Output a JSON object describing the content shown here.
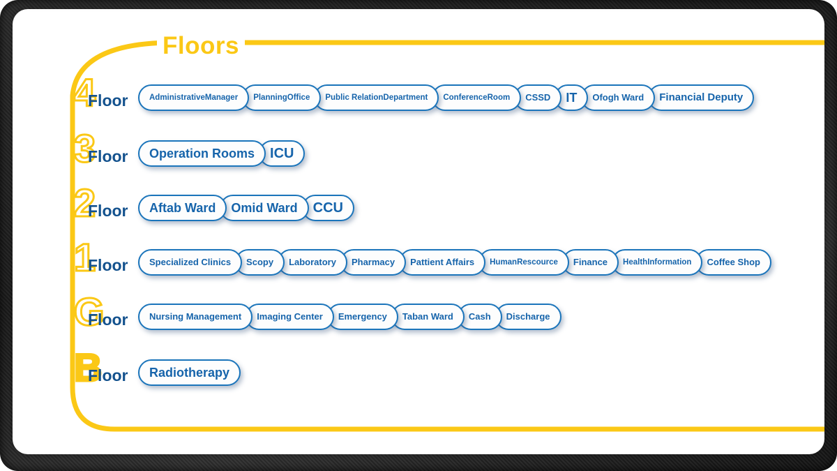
{
  "title": "Floors",
  "colors": {
    "accent_yellow": "#fbc816",
    "pill_border_blue": "#1b75bb",
    "pill_text_blue": "#1664ab",
    "floor_word_blue": "#14528e",
    "card_background": "#ffffff",
    "frame_dark": "#1d1d1d"
  },
  "floor_word": "Floor",
  "floors": [
    {
      "number": "4",
      "label": "Floor",
      "rooms": [
        {
          "lines": [
            "Administrative",
            "Manager"
          ],
          "size": "size-sm"
        },
        {
          "lines": [
            "Planning",
            "Office"
          ],
          "size": "size-sm"
        },
        {
          "lines": [
            "Public Relation",
            "Department"
          ],
          "size": "size-sm"
        },
        {
          "lines": [
            "Conference",
            "Room"
          ],
          "size": "size-sm"
        },
        {
          "lines": [
            "CSSD"
          ],
          "size": "size-md"
        },
        {
          "lines": [
            "IT"
          ],
          "size": "size-xl"
        },
        {
          "lines": [
            "Ofogh Ward"
          ],
          "size": "size-md"
        },
        {
          "lines": [
            "Financial Deputy"
          ],
          "size": "size-lg"
        }
      ]
    },
    {
      "number": "3",
      "label": "Floor",
      "rooms": [
        {
          "lines": [
            "Operation Rooms"
          ],
          "size": "size-xl"
        },
        {
          "lines": [
            "ICU"
          ],
          "size": "size-xxl"
        }
      ]
    },
    {
      "number": "2",
      "label": "Floor",
      "rooms": [
        {
          "lines": [
            "Aftab Ward"
          ],
          "size": "size-xl"
        },
        {
          "lines": [
            "Omid Ward"
          ],
          "size": "size-xl"
        },
        {
          "lines": [
            "CCU"
          ],
          "size": "size-xxl"
        }
      ]
    },
    {
      "number": "1",
      "label": "Floor",
      "rooms": [
        {
          "lines": [
            "Specialized Clinics"
          ],
          "size": "size-md"
        },
        {
          "lines": [
            "Scopy"
          ],
          "size": "size-md"
        },
        {
          "lines": [
            "Laboratory"
          ],
          "size": "size-md"
        },
        {
          "lines": [
            "Pharmacy"
          ],
          "size": "size-md"
        },
        {
          "lines": [
            "Pattient Affairs"
          ],
          "size": "size-md"
        },
        {
          "lines": [
            "Human",
            "Rescource"
          ],
          "size": "size-sm"
        },
        {
          "lines": [
            "Finance"
          ],
          "size": "size-md"
        },
        {
          "lines": [
            "Health",
            "Information"
          ],
          "size": "size-sm"
        },
        {
          "lines": [
            "Coffee Shop"
          ],
          "size": "size-md"
        }
      ]
    },
    {
      "number": "G",
      "label": "Floor",
      "rooms": [
        {
          "lines": [
            "Nursing Management"
          ],
          "size": "size-md"
        },
        {
          "lines": [
            "Imaging Center"
          ],
          "size": "size-md"
        },
        {
          "lines": [
            "Emergency"
          ],
          "size": "size-md"
        },
        {
          "lines": [
            "Taban Ward"
          ],
          "size": "size-md"
        },
        {
          "lines": [
            "Cash"
          ],
          "size": "size-md"
        },
        {
          "lines": [
            "Discharge"
          ],
          "size": "size-md"
        }
      ]
    },
    {
      "number": "B",
      "label": "Floor",
      "solid_digit": true,
      "rooms": [
        {
          "lines": [
            "Radiotherapy"
          ],
          "size": "size-xl"
        }
      ]
    }
  ]
}
